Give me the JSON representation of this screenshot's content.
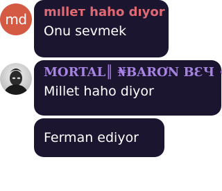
{
  "colors": {
    "bubble": "#1b1530",
    "avatar_initials_bg": "#d45a44",
    "name1": "#e06a73",
    "name2": "#a784e2"
  },
  "messages": [
    {
      "avatar": {
        "type": "initials",
        "text": "md"
      },
      "sender": "mılleт haho dıyor",
      "text": "Onu sevmek"
    },
    {
      "avatar": {
        "type": "photo"
      },
      "sender": "MORTAL║ ₦BARƠN BƐЧ •",
      "text": "Millet haho diyor"
    },
    {
      "text": "Ferman ediyor"
    }
  ]
}
